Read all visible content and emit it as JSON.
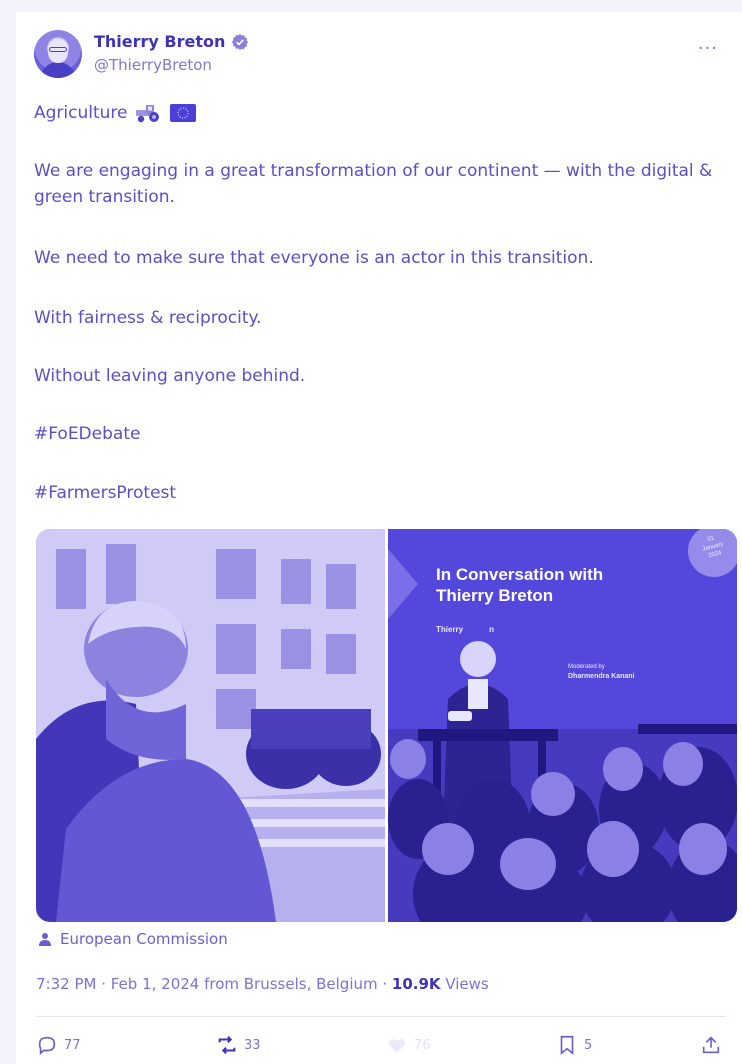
{
  "author": {
    "name": "Thierry Breton",
    "handle": "@ThierryBreton"
  },
  "post": {
    "title_line": "Agriculture",
    "paragraphs": [
      "We are engaging in a great transformation of our continent — with the digital & green transition.",
      "We need to make sure that everyone is an actor in this transition.",
      "With fairness & reciprocity.",
      "Without leaving anyone behind."
    ],
    "hashtags": [
      "#FoEDebate",
      "#FarmersProtest"
    ]
  },
  "media": {
    "right_slide": {
      "headline_line1": "In Conversation with",
      "headline_line2": "Thierry Breton",
      "speaker_name_partial": "Thierry",
      "speaker_name_suffix": "n",
      "moderated_label": "Moderated by",
      "moderator": "Dharmendra Kanani",
      "date_badge_day": "01",
      "date_badge_month": "January",
      "date_badge_year": "2024"
    }
  },
  "credit": "European Commission",
  "meta": {
    "time_date_place": "7:32 PM · Feb 1, 2024 from Brussels, Belgium · ",
    "views_count": "10.9K",
    "views_label": " Views"
  },
  "actions": {
    "replies": "77",
    "reposts": "33",
    "likes": "76",
    "bookmarks": "5"
  },
  "colors": {
    "accent": "#5b4fc9",
    "accent_dark": "#3e32b8",
    "muted": "#7c73d6"
  },
  "icons": [
    "verified-icon",
    "more-icon",
    "tractor-icon",
    "eu-flag-icon",
    "person-icon",
    "reply-icon",
    "repost-icon",
    "like-icon",
    "bookmark-icon",
    "share-icon"
  ]
}
